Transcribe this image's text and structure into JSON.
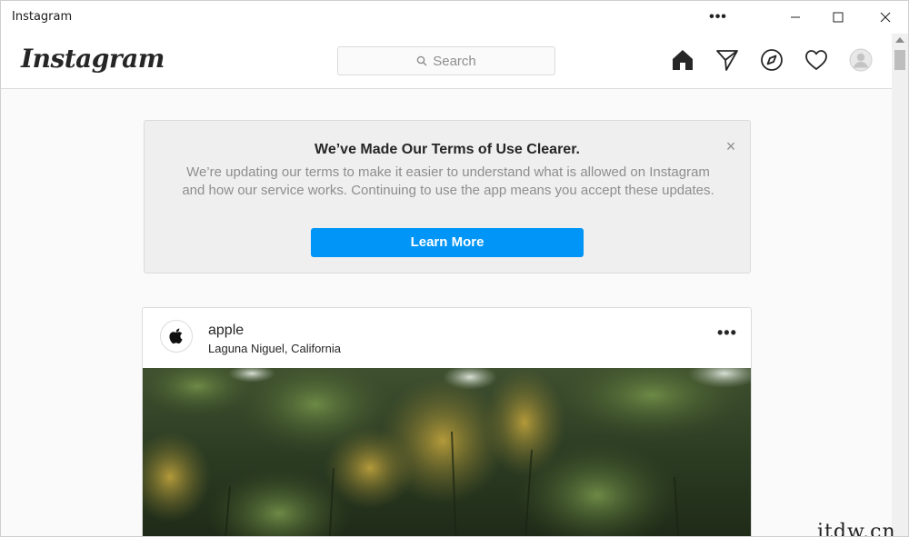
{
  "window": {
    "title": "Instagram",
    "more_glyph": "•••"
  },
  "header": {
    "logo": "Instagram",
    "search_placeholder": "Search",
    "icons": [
      "home-icon",
      "direct-icon",
      "explore-icon",
      "heart-icon",
      "avatar-icon"
    ]
  },
  "notice": {
    "title": "We’ve Made Our Terms of Use Clearer.",
    "body": "We’re updating our terms to make it easier to understand what is allowed on Instagram and how our service works. Continuing to use the app means you accept these updates.",
    "close": "×",
    "button_label": "Learn More"
  },
  "post": {
    "username": "apple",
    "location": "Laguna Niguel, California",
    "more_glyph": "•••"
  },
  "watermark": "itdw.cn",
  "colors": {
    "accent": "#0095f6",
    "text": "#262626",
    "muted": "#8e8e8e",
    "border": "#dbdbdb"
  }
}
